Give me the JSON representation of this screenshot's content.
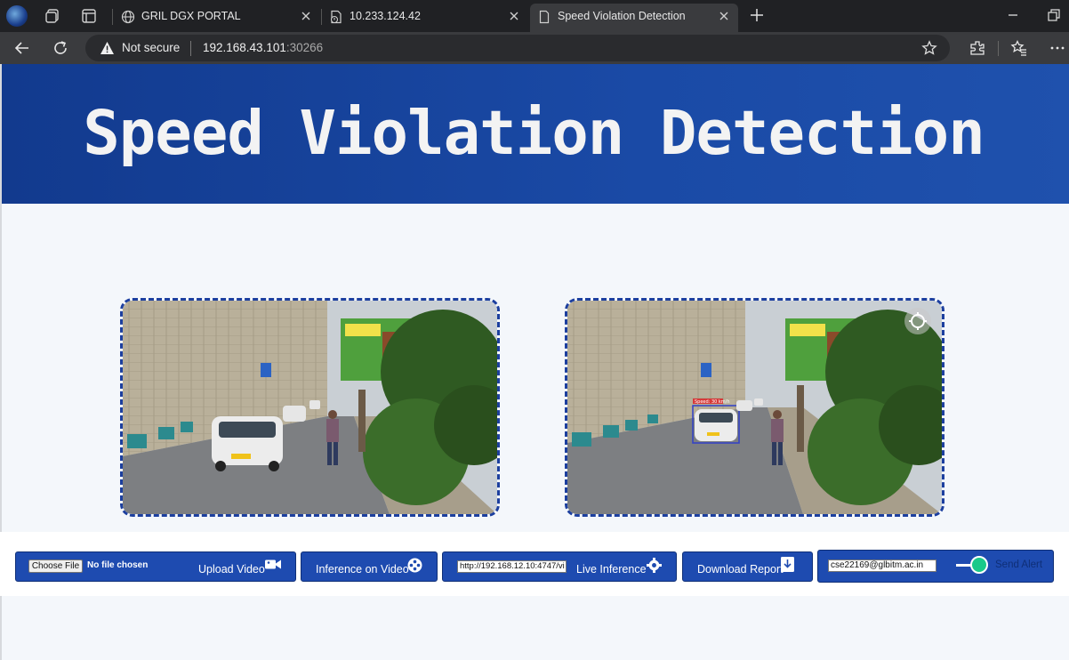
{
  "browser": {
    "tabs": [
      {
        "title": "GRIL DGX PORTAL",
        "active": false
      },
      {
        "title": "10.233.124.42",
        "active": false
      },
      {
        "title": "Speed Violation Detection",
        "active": true
      }
    ],
    "security_label": "Not secure",
    "url_host": "192.168.43.101",
    "url_port": ":30266"
  },
  "header": {
    "title": "Speed Violation Detection"
  },
  "videos": {
    "input": {
      "icon": "video-frame"
    },
    "output": {
      "detection_label": "Speed: 30 km/h",
      "icon": "reset-icon"
    }
  },
  "toolbar": {
    "choose_file_label": "Choose File",
    "file_status": "No file chosen",
    "upload_label": "Upload Video",
    "inference_video_label": "Inference on Video",
    "live_url_value": "http://192.168.12.10:4747/vi",
    "live_inference_label": "Live Inference",
    "download_report_label": "Download Report",
    "email_value": "cse22169@glbitm.ac.in",
    "send_alert_label": "Send Alert"
  },
  "colors": {
    "header_bg": "#1a4aa6",
    "button_bg": "#1e4bb0",
    "border_dashed": "#1c3f9f",
    "toggle_on": "#19c98a"
  }
}
